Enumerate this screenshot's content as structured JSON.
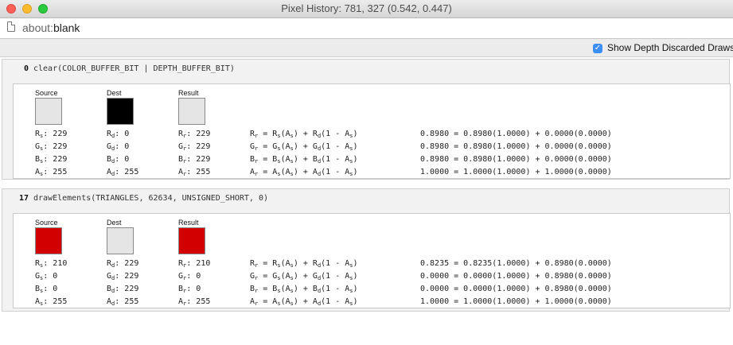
{
  "window": {
    "title": "Pixel History: 781, 327 (0.542, 0.447)",
    "colors": {
      "close": "#fc5f57",
      "minimize": "#fdbc2e",
      "maximize": "#29c940"
    }
  },
  "urlbar": {
    "scheme": "about:",
    "rest": "blank",
    "icon": "page-icon"
  },
  "options": {
    "show_depth_discarded": "Show Depth Discarded Draws",
    "checked": true,
    "accent": "#3d8ef7"
  },
  "swatch_labels": {
    "source": "Source",
    "dest": "Dest",
    "result": "Result"
  },
  "draws": [
    {
      "index": "0",
      "call": "clear(COLOR_BUFFER_BIT | DEPTH_BUFFER_BIT)",
      "source_color": "#e5e5e5",
      "dest_color": "#000000",
      "result_color": "#e5e5e5",
      "rows": [
        {
          "src": "229",
          "dst": "0",
          "res": "229",
          "calc": "0.8980 = 0.8980(1.0000) + 0.0000(0.0000)"
        },
        {
          "src": "229",
          "dst": "0",
          "res": "229",
          "calc": "0.8980 = 0.8980(1.0000) + 0.0000(0.0000)"
        },
        {
          "src": "229",
          "dst": "0",
          "res": "229",
          "calc": "0.8980 = 0.8980(1.0000) + 0.0000(0.0000)"
        },
        {
          "src": "255",
          "dst": "255",
          "res": "255",
          "calc": "1.0000 = 1.0000(1.0000) + 1.0000(0.0000)"
        }
      ]
    },
    {
      "index": "17",
      "call": "drawElements(TRIANGLES, 62634, UNSIGNED_SHORT, 0)",
      "source_color": "#d20000",
      "dest_color": "#e5e5e5",
      "result_color": "#d20000",
      "rows": [
        {
          "src": "210",
          "dst": "229",
          "res": "210",
          "calc": "0.8235 = 0.8235(1.0000) + 0.8980(0.0000)"
        },
        {
          "src": "0",
          "dst": "229",
          "res": "0",
          "calc": "0.0000 = 0.0000(1.0000) + 0.8980(0.0000)"
        },
        {
          "src": "0",
          "dst": "229",
          "res": "0",
          "calc": "0.0000 = 0.0000(1.0000) + 0.8980(0.0000)"
        },
        {
          "src": "255",
          "dst": "255",
          "res": "255",
          "calc": "1.0000 = 1.0000(1.0000) + 1.0000(0.0000)"
        }
      ]
    }
  ]
}
